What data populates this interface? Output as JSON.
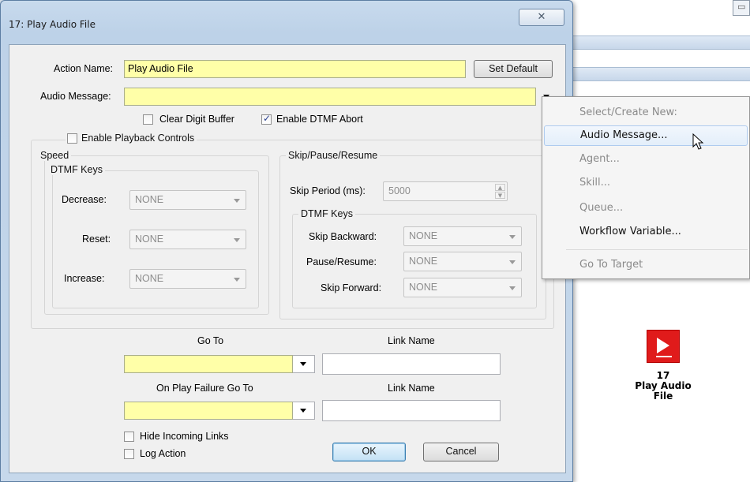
{
  "dialog": {
    "title": "17: Play Audio File",
    "close_symbol": "✕",
    "action_name_label": "Action Name:",
    "action_name_value": "Play Audio File",
    "set_default_label": "Set Default",
    "audio_message_label": "Audio Message:",
    "audio_message_value": "",
    "clear_digit_buffer_label": "Clear Digit Buffer",
    "clear_digit_buffer_checked": false,
    "enable_dtmf_abort_label": "Enable DTMF Abort",
    "enable_dtmf_abort_checked": true,
    "enable_playback_controls_label": "Enable Playback Controls",
    "enable_playback_controls_checked": false,
    "speed": {
      "legend": "Speed",
      "dtmf_legend": "DTMF Keys",
      "decrease_label": "Decrease:",
      "decrease_value": "NONE",
      "reset_label": "Reset:",
      "reset_value": "NONE",
      "increase_label": "Increase:",
      "increase_value": "NONE"
    },
    "skip": {
      "legend": "Skip/Pause/Resume",
      "skip_period_label": "Skip Period (ms):",
      "skip_period_value": "5000",
      "dtmf_legend": "DTMF Keys",
      "skip_backward_label": "Skip Backward:",
      "skip_backward_value": "NONE",
      "pause_resume_label": "Pause/Resume:",
      "pause_resume_value": "NONE",
      "skip_forward_label": "Skip Forward:",
      "skip_forward_value": "NONE"
    },
    "goto_label": "Go To",
    "link_name_label": "Link Name",
    "goto_value": "",
    "link_name_value": "",
    "on_failure_label": "On Play Failure Go To",
    "failure_link_name_label": "Link Name",
    "on_failure_value": "",
    "failure_link_name_value": "",
    "hide_incoming_links_label": "Hide Incoming Links",
    "hide_incoming_links_checked": false,
    "log_action_label": "Log Action",
    "log_action_checked": false,
    "ok_label": "OK",
    "cancel_label": "Cancel"
  },
  "context_menu": {
    "items": [
      {
        "label": "Select/Create New:",
        "enabled": false
      },
      {
        "label": "Audio Message...",
        "enabled": true,
        "highlighted": true
      },
      {
        "label": "Agent...",
        "enabled": false
      },
      {
        "label": "Skill...",
        "enabled": false
      },
      {
        "label": "Queue...",
        "enabled": false
      },
      {
        "label": "Workflow Variable...",
        "enabled": true
      },
      {
        "label": "Go To Target",
        "enabled": false
      }
    ]
  },
  "workflow_node": {
    "number": "17",
    "line1": "Play Audio",
    "line2": "File",
    "icon": "play-icon",
    "color": "#e01b1b"
  },
  "colors": {
    "required_field": "#ffffa8",
    "menu_highlight": "#e3eefa"
  }
}
